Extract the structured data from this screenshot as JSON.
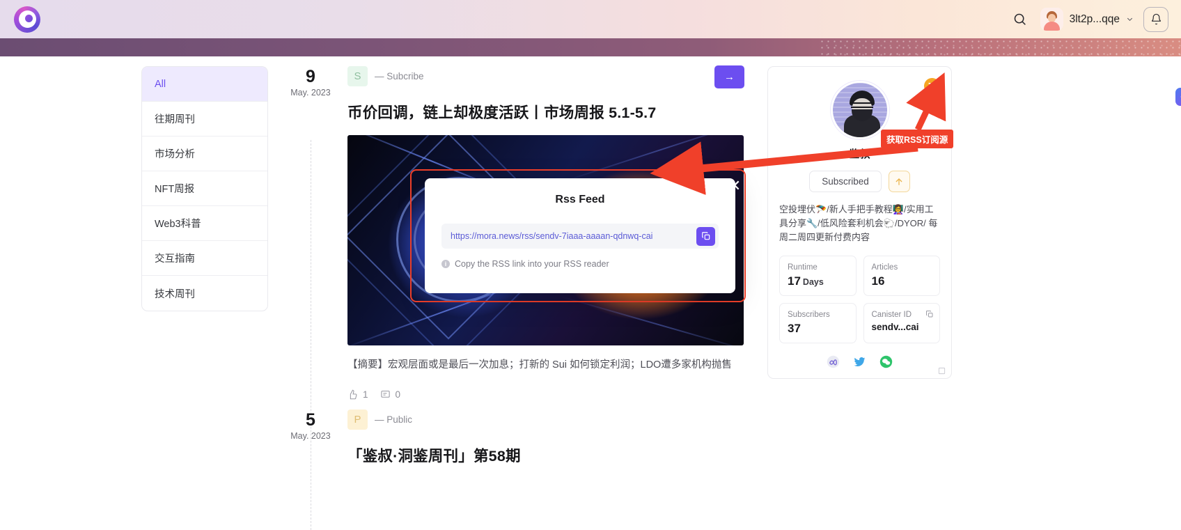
{
  "header": {
    "logo_alt": "mora-logo",
    "search_icon": "search-icon",
    "user_name": "3lt2p...qqe",
    "bell_icon": "bell-icon"
  },
  "sidebar": {
    "items": [
      {
        "label": "All",
        "active": true
      },
      {
        "label": "往期周刊",
        "active": false
      },
      {
        "label": "市场分析",
        "active": false
      },
      {
        "label": "NFT周报",
        "active": false
      },
      {
        "label": "Web3科普",
        "active": false
      },
      {
        "label": "交互指南",
        "active": false
      },
      {
        "label": "技术周刊",
        "active": false
      }
    ]
  },
  "articles": [
    {
      "day": "9",
      "month_year": "May. 2023",
      "badge_letter": "S",
      "visibility": "— Subcribe",
      "title": "币价回调，链上却极度活跃丨市场周报 5.1-5.7",
      "summary": "【摘要】宏观层面或是最后一次加息；打新的 Sui 如何锁定利润；LDO遭多家机构抛售",
      "likes": "1",
      "comments": "0",
      "read_more": "→"
    },
    {
      "day": "5",
      "month_year": "May. 2023",
      "badge_letter": "P",
      "visibility": "— Public",
      "title": "「鉴叔·洞鉴周刊」第58期"
    }
  ],
  "profile": {
    "name": "鉴叔",
    "subscribe_button": "Subscribed",
    "boost_icon": "boost-arrow-icon",
    "rss_icon": "rss-icon",
    "bio": "空投埋伏🪂/新人手把手教程👩‍🏫/实用工具分享🔧/低风险套利机会🐑/DYOR/ 每周二周四更新付费内容",
    "stats": [
      {
        "label": "Runtime",
        "value": "17",
        "unit": "Days",
        "copyable": false
      },
      {
        "label": "Articles",
        "value": "16",
        "unit": "",
        "copyable": false
      },
      {
        "label": "Subscribers",
        "value": "37",
        "unit": "",
        "copyable": false
      },
      {
        "label": "Canister ID",
        "value": "sendv...cai",
        "unit": "",
        "copyable": true,
        "small": true
      }
    ],
    "socials": [
      "dfinity-icon",
      "twitter-icon",
      "wechat-icon"
    ]
  },
  "modal": {
    "title": "Rss Feed",
    "url": "https://mora.news/rss/sendv-7iaaa-aaaan-qdnwq-cai",
    "copy_icon": "copy-icon",
    "hint": "Copy the RSS link into your RSS reader",
    "close_icon": "close-icon"
  },
  "annotation": {
    "tooltip": "获取RSS订阅源",
    "accent_color": "#f0402a"
  },
  "float_widget": {
    "icon": "chat-support-icon"
  }
}
